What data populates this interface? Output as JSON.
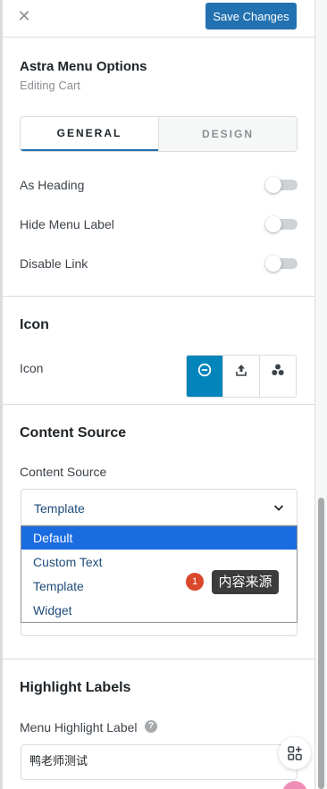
{
  "header": {
    "close_icon": "close-icon",
    "save_label": "Save Changes",
    "accent": "#2271b1"
  },
  "panel": {
    "title": "Astra Menu Options",
    "subtitle": "Editing Cart"
  },
  "tabs": [
    {
      "label": "GENERAL",
      "active": true
    },
    {
      "label": "DESIGN",
      "active": false
    }
  ],
  "toggles": [
    {
      "label": "As Heading",
      "on": false
    },
    {
      "label": "Hide Menu Label",
      "on": false
    },
    {
      "label": "Disable Link",
      "on": false
    }
  ],
  "icon_section": {
    "title": "Icon",
    "label": "Icon",
    "options": [
      {
        "icon": "minus-circle-icon",
        "active": true
      },
      {
        "icon": "upload-icon",
        "active": false
      },
      {
        "icon": "dots-cluster-icon",
        "active": false
      }
    ]
  },
  "content_source": {
    "title": "Content Source",
    "label": "Content Source",
    "selected_value": "Template",
    "options": [
      "Default",
      "Custom Text",
      "Template",
      "Widget"
    ],
    "highlighted_option": "Default"
  },
  "annotation": {
    "badge_number": "1",
    "tooltip_text": "内容来源",
    "badge_color": "#d9482b"
  },
  "highlight_labels": {
    "title": "Highlight Labels",
    "label": "Menu Highlight Label",
    "help_icon": "?",
    "input_value": "鸭老师测试"
  }
}
